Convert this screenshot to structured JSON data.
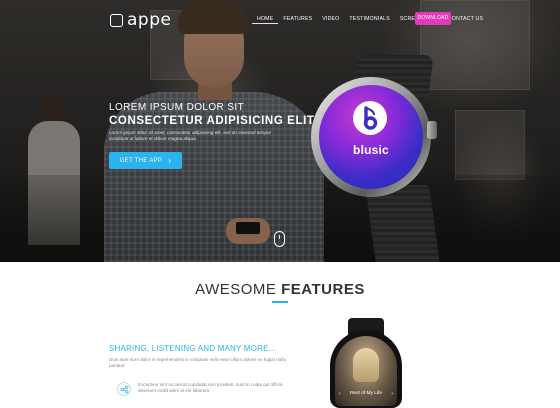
{
  "brand": {
    "name": "appe"
  },
  "nav": {
    "items": [
      {
        "label": "HOME",
        "active": true
      },
      {
        "label": "FEATURES",
        "active": false
      },
      {
        "label": "VIDEO",
        "active": false
      },
      {
        "label": "TESTIMONIALS",
        "active": false
      },
      {
        "label": "SCREENSHOT",
        "active": false
      },
      {
        "label": "CONTACT US",
        "active": false
      }
    ],
    "download_label": "DOWNLOAD"
  },
  "hero": {
    "line1": "LOREM IPSUM DOLOR SIT",
    "line2": "CONSECTETUR ADIPISICING ELIT",
    "body": "Lorem ipsum dolor sit amet, consectetur adipisicing elit, sed do eiusmod tempor incididunt ut labore et dolore magna aliqua.",
    "cta_label": "GET THE APP",
    "watch_app_name": "blusic"
  },
  "features": {
    "title_light": "AWESOME",
    "title_bold": "FEATURES",
    "subheading": "SHARING, LISTENING AND MANY MORE...",
    "subtext": "Duis aute irure dolor in reprehenderit in voluptate velit esse cillum dolore eu fugiat nulla pariatur.",
    "item_text": "Excepteur sint occaecat cupidatat non proident, sunt in culpa qui officia deserunt mollit anim id est laborum.",
    "watch_track": "Rest of My Life"
  },
  "colors": {
    "accent": "#2ab3ef",
    "download": "#e23ab8"
  }
}
